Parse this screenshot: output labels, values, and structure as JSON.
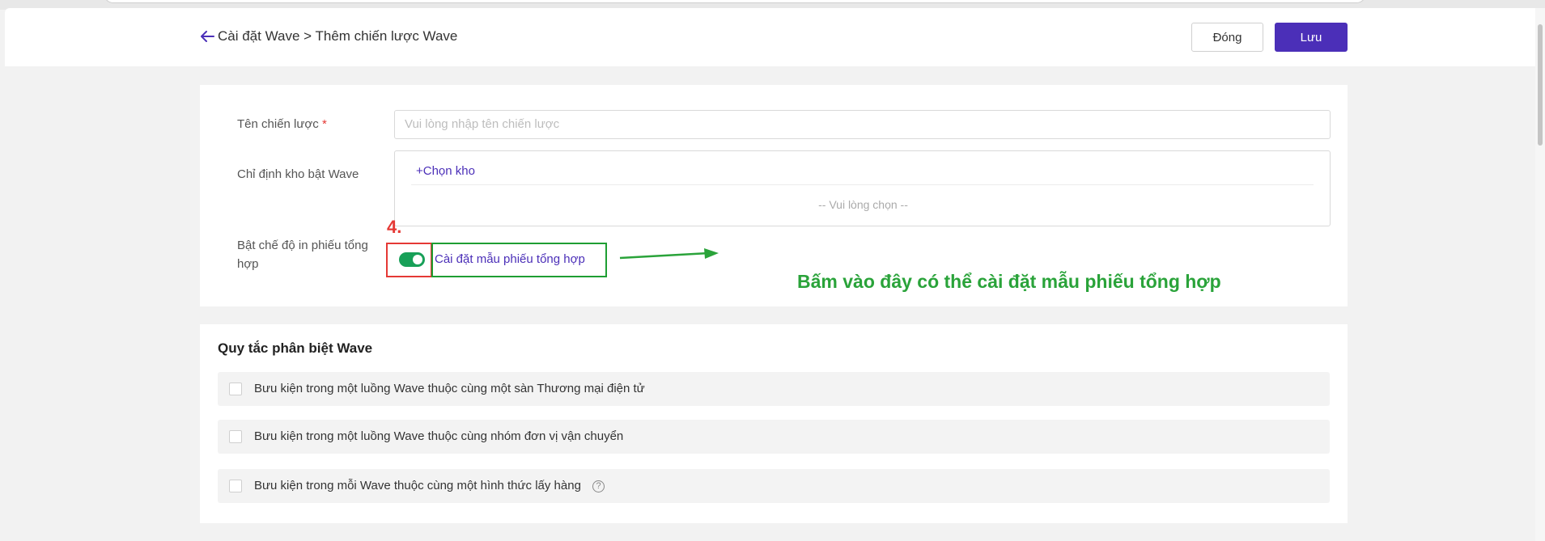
{
  "header": {
    "breadcrumb": "Cài đặt Wave > Thêm chiến lược Wave",
    "close_label": "Đóng",
    "save_label": "Lưu"
  },
  "form": {
    "strategy_name_label": "Tên chiến lược",
    "required_mark": "*",
    "strategy_name_placeholder": "Vui lòng nhập tên chiến lược",
    "strategy_name_value": "",
    "warehouse_label": "Chỉ định kho bật Wave",
    "choose_warehouse": "+Chọn kho",
    "warehouse_empty": "-- Vui lòng chọn --",
    "summary_print_label": "Bật chế độ in phiếu tổng hợp",
    "summary_print_enabled": true,
    "summary_template_link": "Cài đặt mẫu phiếu tổng hợp"
  },
  "annotation": {
    "step": "4.",
    "note": "Bấm vào đây có thể cài đặt mẫu phiếu tổng hợp",
    "highlight_red": "#e53935",
    "highlight_green": "#1e9e33"
  },
  "rules": {
    "title": "Quy tắc phân biệt Wave",
    "items": [
      {
        "label": "Bưu kiện trong một luồng Wave thuộc cùng một sàn Thương mại điện tử",
        "checked": false,
        "help": false
      },
      {
        "label": "Bưu kiện trong một luồng Wave thuộc cùng nhóm đơn vị vận chuyển",
        "checked": false,
        "help": false
      },
      {
        "label": "Bưu kiện trong mỗi Wave thuộc cùng một hình thức lấy hàng",
        "checked": false,
        "help": true
      }
    ]
  },
  "icons": {
    "back": "arrow-left-icon",
    "help": "question-circle-icon"
  },
  "colors": {
    "accent": "#4b2fb8",
    "toggle_on": "#18a058"
  }
}
